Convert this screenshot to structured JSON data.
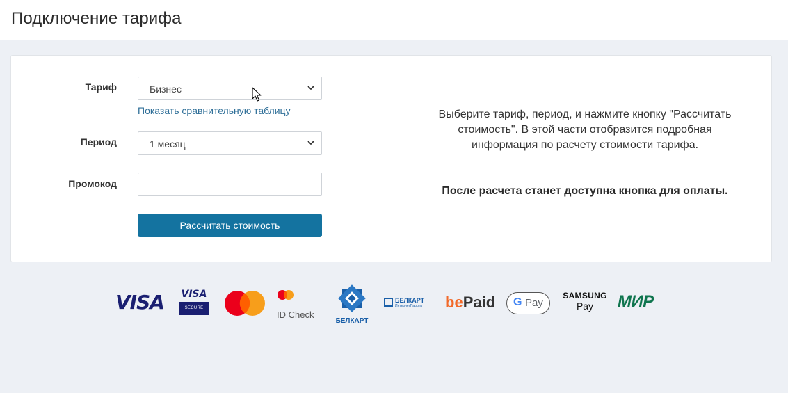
{
  "header": {
    "title": "Подключение тарифа"
  },
  "form": {
    "tariff_label": "Тариф",
    "tariff_value": "Бизнес",
    "compare_link": "Показать сравнительную таблицу",
    "period_label": "Период",
    "period_value": "1 месяц",
    "promo_label": "Промокод",
    "promo_value": "",
    "calc_button": "Рассчитать стоимость"
  },
  "info": {
    "text": "Выберите тариф, период, и нажмите кнопку \"Рассчитать стоимость\". В этой части отобразится подробная информация по расчету стоимости тарифа.",
    "bold_text": "После расчета станет доступна кнопка для оплаты."
  },
  "payment_logos": {
    "visa": "VISA",
    "visa_secure_top": "VISA",
    "visa_secure_bottom": "SECURE",
    "id_check": "ID Check",
    "belkart": "БЕЛКАРТ",
    "belkart_ip_top": "БЕЛКАРТ",
    "belkart_ip_bottom": "ИнтернетПароль",
    "bepaid_be": "be",
    "bepaid_paid": "Paid",
    "gpay_g": "G",
    "gpay_pay": "Pay",
    "samsung_top": "SAMSUNG",
    "samsung_bottom": "Pay",
    "mir": "МИР"
  },
  "colors": {
    "button": "#1473a0",
    "link": "#2f6f98",
    "background": "#edf0f5",
    "visa_blue": "#1a1f71",
    "mastercard_red": "#eb001b",
    "mastercard_orange": "#f79e1b",
    "belkart_blue": "#1a5fa8",
    "bepaid_orange": "#f26a2a",
    "mir_green": "#0f754e"
  }
}
